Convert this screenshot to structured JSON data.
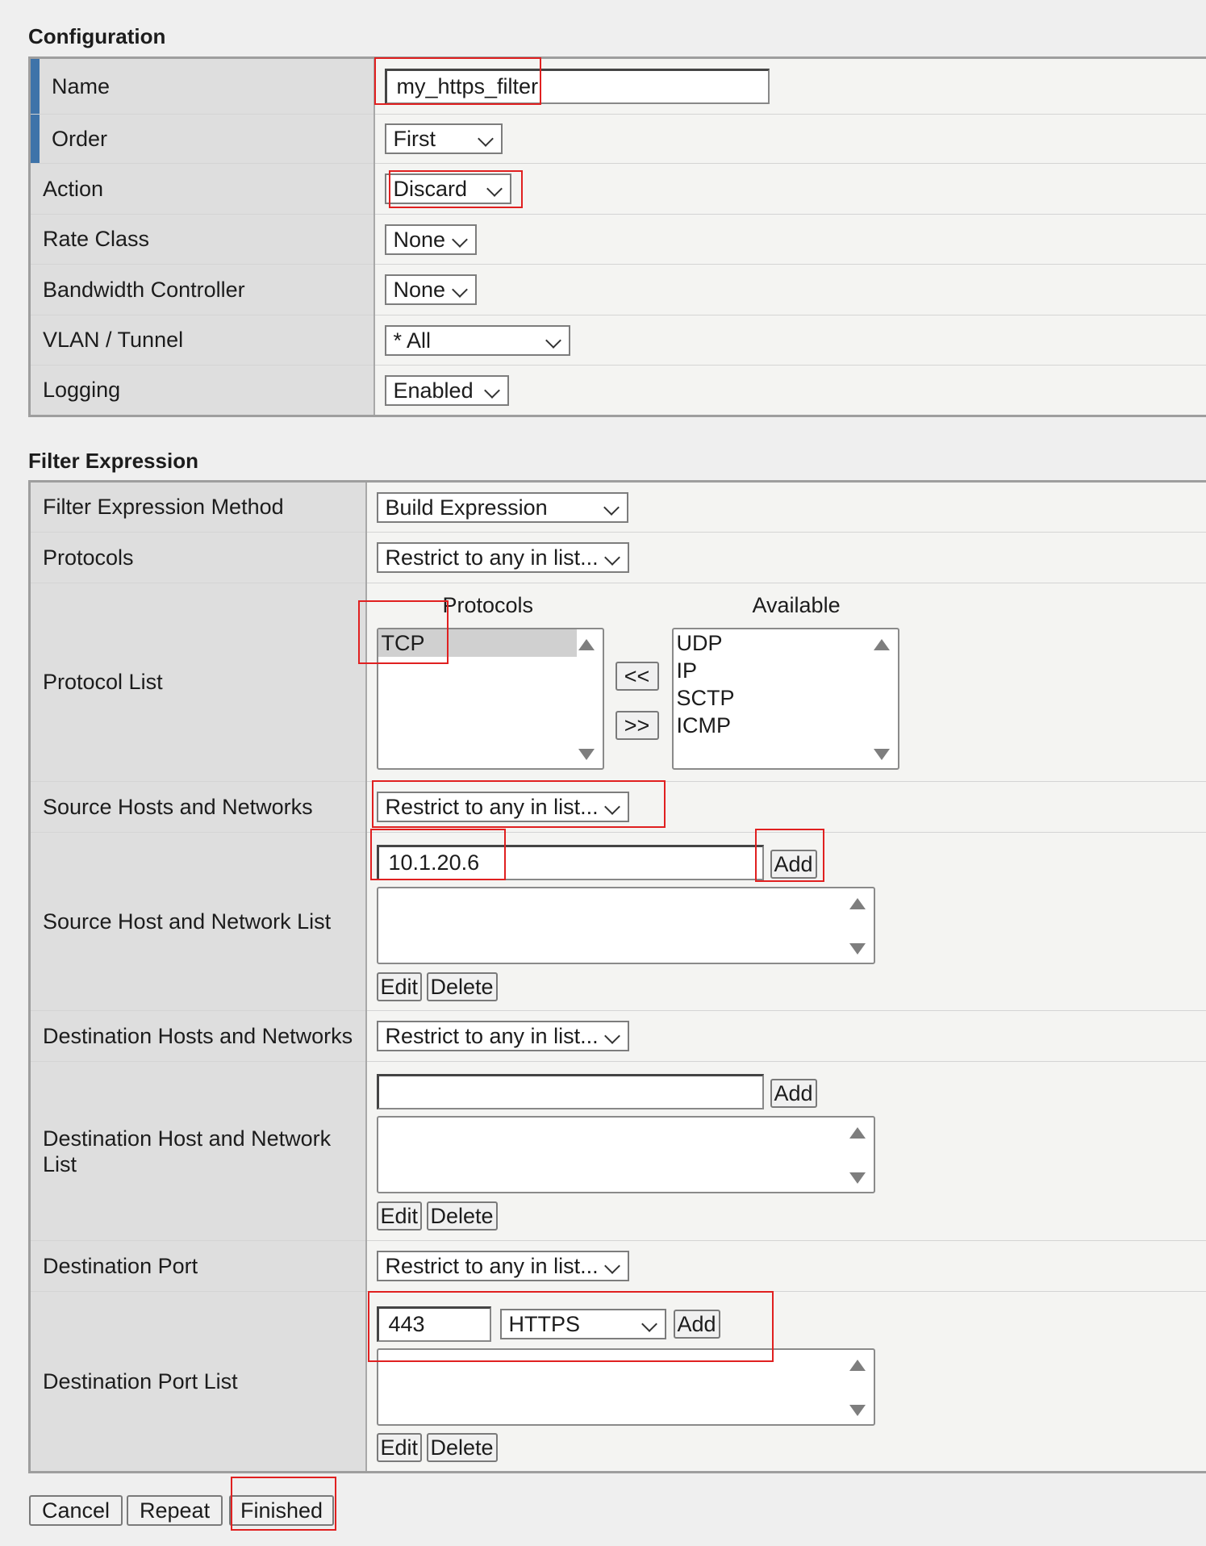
{
  "configuration": {
    "title": "Configuration",
    "name_label": "Name",
    "name_value": "my_https_filter",
    "order_label": "Order",
    "order_value": "First",
    "action_label": "Action",
    "action_value": "Discard",
    "rate_class_label": "Rate Class",
    "rate_class_value": "None",
    "bandwidth_label": "Bandwidth Controller",
    "bandwidth_value": "None",
    "vlan_label": "VLAN / Tunnel",
    "vlan_value": "* All",
    "logging_label": "Logging",
    "logging_value": "Enabled"
  },
  "filter": {
    "title": "Filter Expression",
    "method_label": "Filter Expression Method",
    "method_value": "Build Expression",
    "protocols_label": "Protocols",
    "protocols_value": "Restrict to any in list...",
    "protocol_list_label": "Protocol List",
    "selected_header": "Protocols",
    "available_header": "Available",
    "selected_protocols": [
      "TCP"
    ],
    "available_protocols": [
      "UDP",
      "IP",
      "SCTP",
      "ICMP"
    ],
    "move_left_label": "<<",
    "move_right_label": ">>",
    "src_label": "Source Hosts and Networks",
    "src_value": "Restrict to any in list...",
    "src_list_label": "Source Host and Network List",
    "src_input_value": "10.1.20.6",
    "dst_label": "Destination Hosts and Networks",
    "dst_value": "Restrict to any in list...",
    "dst_list_label_line1": "Destination Host and Network",
    "dst_list_label_line2": "List",
    "dst_input_value": "",
    "port_label": "Destination Port",
    "port_value": "Restrict to any in list...",
    "port_list_label": "Destination Port List",
    "port_input_value": "443",
    "port_service_value": "HTTPS",
    "add_label": "Add",
    "edit_label": "Edit",
    "delete_label": "Delete"
  },
  "footer": {
    "cancel_label": "Cancel",
    "repeat_label": "Repeat",
    "finished_label": "Finished"
  }
}
